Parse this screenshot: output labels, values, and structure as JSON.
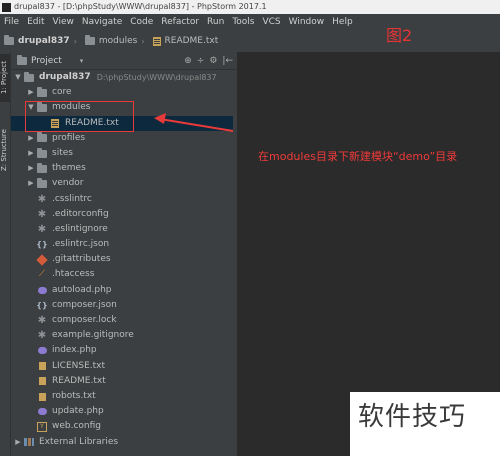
{
  "window": {
    "title": "drupal837 - [D:\\phpStudy\\WWW\\drupal837] - PhpStorm 2017.1"
  },
  "menu": [
    "File",
    "Edit",
    "View",
    "Navigate",
    "Code",
    "Refactor",
    "Run",
    "Tools",
    "VCS",
    "Window",
    "Help"
  ],
  "breadcrumb": {
    "root": "drupal837",
    "folder": "modules",
    "file": "README.txt"
  },
  "figure_label": "图2",
  "side_tabs": {
    "project": "1: Project",
    "structure": "Z: Structure"
  },
  "panel": {
    "title": "Project",
    "dropdown": "▾",
    "tools": [
      "⊕",
      "÷",
      "⚙",
      "|←"
    ]
  },
  "tree": {
    "root": {
      "name": "drupal837",
      "path": "D:\\phpStudy\\WWW\\drupal837"
    },
    "items": [
      {
        "name": "core"
      },
      {
        "name": "modules"
      },
      {
        "name": "README.txt"
      },
      {
        "name": "profiles"
      },
      {
        "name": "sites"
      },
      {
        "name": "themes"
      },
      {
        "name": "vendor"
      },
      {
        "name": ".csslintrc"
      },
      {
        "name": ".editorconfig"
      },
      {
        "name": ".eslintignore"
      },
      {
        "name": ".eslintrc.json"
      },
      {
        "name": ".gitattributes"
      },
      {
        "name": ".htaccess"
      },
      {
        "name": "autoload.php"
      },
      {
        "name": "composer.json"
      },
      {
        "name": "composer.lock"
      },
      {
        "name": "example.gitignore"
      },
      {
        "name": "index.php"
      },
      {
        "name": "LICENSE.txt"
      },
      {
        "name": "README.txt"
      },
      {
        "name": "robots.txt"
      },
      {
        "name": "update.php"
      },
      {
        "name": "web.config"
      }
    ],
    "external": "External Libraries"
  },
  "annotation": "在modules目录下新建模块“demo”目录",
  "watermark": "软件技巧",
  "colors": {
    "annotation": "#f03a3a",
    "selection": "#0d293e"
  }
}
